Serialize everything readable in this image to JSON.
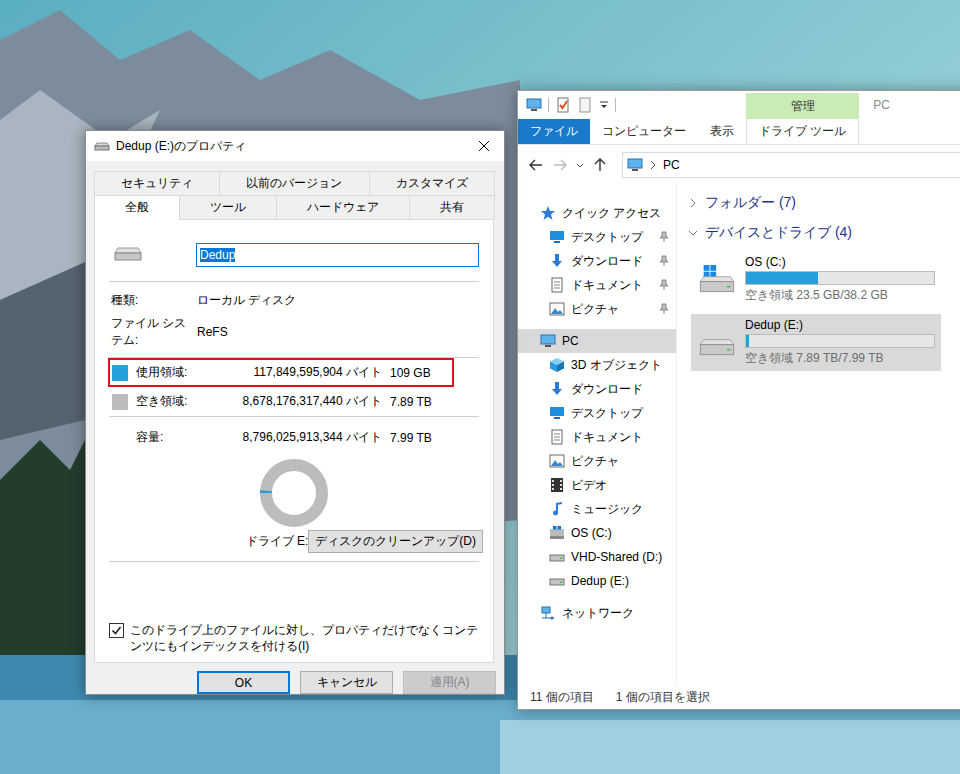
{
  "dialog": {
    "title": "Dedup (E:)のプロパティ",
    "tab_rows": [
      [
        {
          "label": "セキュリティ",
          "selected": false
        },
        {
          "label": "以前のバージョン",
          "selected": false
        },
        {
          "label": "カスタマイズ",
          "selected": false
        }
      ],
      [
        {
          "label": "全般",
          "selected": true
        },
        {
          "label": "ツール",
          "selected": false
        },
        {
          "label": "ハードウェア",
          "selected": false
        },
        {
          "label": "共有",
          "selected": false
        }
      ]
    ],
    "name_field": {
      "value": "Dedup",
      "selected": true
    },
    "info": [
      {
        "label": "種類:",
        "value": "ローカル ディスク"
      },
      {
        "label": "ファイル システム:",
        "value": "ReFS"
      }
    ],
    "usage": [
      {
        "label": "使用領域:",
        "bytes": "117,849,595,904 バイト",
        "size": "109 GB",
        "color": "#26a0da",
        "highlighted": true
      },
      {
        "label": "空き領域:",
        "bytes": "8,678,176,317,440 バイト",
        "size": "7.89 TB",
        "color": "#bcbcbc",
        "highlighted": false
      }
    ],
    "capacity": {
      "label": "容量:",
      "bytes": "8,796,025,913,344 バイト",
      "size": "7.99 TB"
    },
    "donut": {
      "level": 0.0134,
      "caption": "ドライブ E:"
    },
    "cleanup_button": "ディスクのクリーンアップ(D)",
    "index_checkbox": {
      "label": "このドライブ上のファイルに対し、プロパティだけでなくコンテンツにもインデックスを付ける(I)",
      "checked": true
    },
    "buttons": [
      {
        "label": "OK",
        "focused": true,
        "disabled": false
      },
      {
        "label": "キャンセル",
        "focused": false,
        "disabled": false
      },
      {
        "label": "適用(A)",
        "focused": false,
        "disabled": true
      }
    ]
  },
  "explorer": {
    "title": "PC",
    "context_group": "管理",
    "ribbon_tabs": [
      {
        "label": "ファイル",
        "kind": "file"
      },
      {
        "label": "コンピューター",
        "kind": "normal"
      },
      {
        "label": "表示",
        "kind": "normal"
      },
      {
        "label": "ドライブ ツール",
        "kind": "context"
      }
    ],
    "address": [
      "PC"
    ],
    "nav_groups": [
      {
        "label": "クイック アクセス",
        "kind": "star",
        "selected": false,
        "children": [
          {
            "label": "デスクトップ",
            "kind": "desktop",
            "pinned": true,
            "selected": false
          },
          {
            "label": "ダウンロード",
            "kind": "download",
            "pinned": true,
            "selected": false
          },
          {
            "label": "ドキュメント",
            "kind": "document",
            "pinned": true,
            "selected": false
          },
          {
            "label": "ピクチャ",
            "kind": "picture",
            "pinned": true,
            "selected": false
          }
        ]
      },
      {
        "label": "PC",
        "kind": "pc",
        "selected": true,
        "children": [
          {
            "label": "3D オブジェクト",
            "kind": "cube",
            "pinned": false,
            "selected": false
          },
          {
            "label": "ダウンロード",
            "kind": "download",
            "pinned": false,
            "selected": false
          },
          {
            "label": "デスクトップ",
            "kind": "desktop",
            "pinned": false,
            "selected": false
          },
          {
            "label": "ドキュメント",
            "kind": "document",
            "pinned": false,
            "selected": false
          },
          {
            "label": "ピクチャ",
            "kind": "picture",
            "pinned": false,
            "selected": false
          },
          {
            "label": "ビデオ",
            "kind": "video",
            "pinned": false,
            "selected": false
          },
          {
            "label": "ミュージック",
            "kind": "music",
            "pinned": false,
            "selected": false
          },
          {
            "label": "OS (C:)",
            "kind": "windows",
            "pinned": false,
            "selected": false
          },
          {
            "label": "VHD-Shared (D:)",
            "kind": "drive",
            "pinned": false,
            "selected": false
          },
          {
            "label": "Dedup (E:)",
            "kind": "drive",
            "pinned": false,
            "selected": false
          }
        ]
      },
      {
        "label": "ネットワーク",
        "kind": "network",
        "selected": false,
        "children": []
      }
    ],
    "sections": [
      {
        "label": "フォルダー (7)",
        "expanded": false
      },
      {
        "label": "デバイスとドライブ (4)",
        "expanded": true
      }
    ],
    "drives": [
      {
        "name": "OS (C:)",
        "free": "空き領域 23.5 GB/38.2 GB",
        "level": 0.385,
        "kind": "windows",
        "selected": false
      },
      {
        "name": "Dedup (E:)",
        "free": "空き領域 7.89 TB/7.99 TB",
        "level": 0.0134,
        "kind": "drive",
        "selected": true
      }
    ],
    "status": [
      "11 個の項目",
      "1 個の項目を選択"
    ]
  }
}
